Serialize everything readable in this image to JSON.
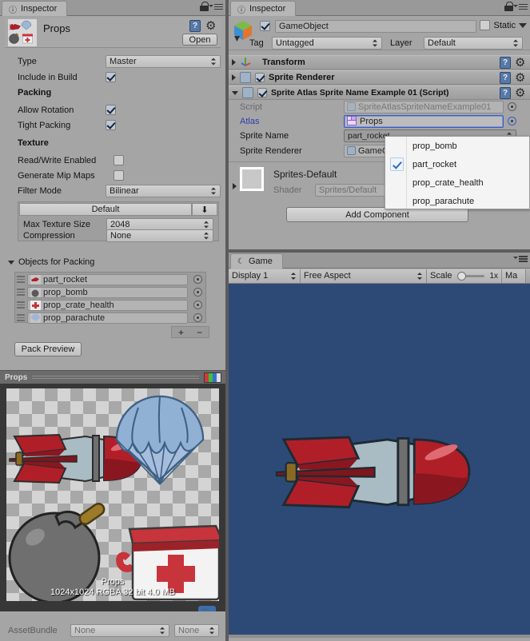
{
  "colors": {
    "panel_bg": "#a5a5a5",
    "game_bg": "#2d4a77",
    "accent_blue": "#3d6fad",
    "link_blue": "#2c3fb0",
    "rocket_red": "#b01f28",
    "rocket_body": "#a9bcc4"
  },
  "left_panel": {
    "tab_label": "Inspector",
    "tab_icon": "info-icon",
    "lock_icon": "lock-icon",
    "menu_icon": "hamburger-icon",
    "asset_title": "Props",
    "help_icon": "help-book-icon",
    "gear_icon": "gear-icon",
    "open_button": "Open",
    "fields": {
      "type_label": "Type",
      "type_value": "Master",
      "include_label": "Include in Build",
      "include_checked": true
    },
    "packing": {
      "section": "Packing",
      "allow_rotation_label": "Allow Rotation",
      "allow_rotation_checked": true,
      "tight_packing_label": "Tight Packing",
      "tight_packing_checked": true
    },
    "texture": {
      "section": "Texture",
      "read_write_label": "Read/Write Enabled",
      "read_write_checked": false,
      "mipmaps_label": "Generate Mip Maps",
      "mipmaps_checked": false,
      "filter_label": "Filter Mode",
      "filter_value": "Bilinear"
    },
    "platform": {
      "tab_label": "Default",
      "download_icon": "download-icon",
      "max_size_label": "Max Texture Size",
      "max_size_value": "2048",
      "compression_label": "Compression",
      "compression_value": "None"
    },
    "objects_for_packing": {
      "header": "Objects for Packing",
      "items": [
        {
          "name": "part_rocket",
          "icon": "sprite-rocket-icon"
        },
        {
          "name": "prop_bomb",
          "icon": "sprite-bomb-icon"
        },
        {
          "name": "prop_crate_health",
          "icon": "sprite-crate-icon"
        },
        {
          "name": "prop_parachute",
          "icon": "sprite-parachute-icon"
        }
      ],
      "add_label": "+",
      "remove_label": "−"
    },
    "pack_preview_button": "Pack Preview",
    "preview": {
      "title": "Props",
      "rgb_icon": "rgb-channels-icon",
      "overlay_name": "Props",
      "overlay_info": "1024x1024 RGBA 32 bit   4.0 MB"
    },
    "tag_icon": "asset-label-icon",
    "assetbundle": {
      "label": "AssetBundle",
      "bundle_value": "None",
      "variant_value": "None"
    }
  },
  "right_panel": {
    "tab_label": "Inspector",
    "tab_icon": "info-icon",
    "lock_icon": "lock-icon",
    "menu_icon": "hamburger-icon",
    "gameobject": {
      "icon": "cube-icon",
      "enabled": true,
      "name": "GameObject",
      "static_label": "Static",
      "static_checked": false,
      "tag_label": "Tag",
      "tag_value": "Untagged",
      "layer_label": "Layer",
      "layer_value": "Default"
    },
    "components": [
      {
        "name": "Transform",
        "icon": "transform-axis-icon",
        "expanded": false,
        "has_toggle": false
      },
      {
        "name": "Sprite Renderer",
        "icon": "sprite-renderer-icon",
        "expanded": false,
        "has_toggle": true,
        "enabled": true
      },
      {
        "name": "Sprite Atlas Sprite Name Example 01 (Script)",
        "icon": "script-icon",
        "expanded": true,
        "has_toggle": true,
        "enabled": true
      }
    ],
    "script_fields": {
      "script_label": "Script",
      "script_value": "SpriteAtlasSpriteNameExample01",
      "atlas_label": "Atlas",
      "atlas_value": "Props",
      "atlas_icon": "sprite-atlas-icon",
      "sprite_name_label": "Sprite Name",
      "sprite_name_value": "part_rocket",
      "sprite_renderer_label": "Sprite Renderer",
      "sprite_renderer_value": "GameO"
    },
    "material": {
      "name": "Sprites-Default",
      "shader_label": "Shader",
      "shader_value": "Sprites/Default"
    },
    "add_component_button": "Add Component",
    "dropdown_menu": {
      "open": true,
      "selected": "part_rocket",
      "items": [
        "prop_bomb",
        "part_rocket",
        "prop_crate_health",
        "prop_parachute"
      ]
    }
  },
  "game_view": {
    "tab_label": "Game",
    "tab_icon": "game-icon",
    "menu_icon": "hamburger-icon",
    "display_value": "Display 1",
    "aspect_value": "Free Aspect",
    "scale_label": "Scale",
    "scale_value": "1x",
    "maximize_label": "Ma"
  }
}
